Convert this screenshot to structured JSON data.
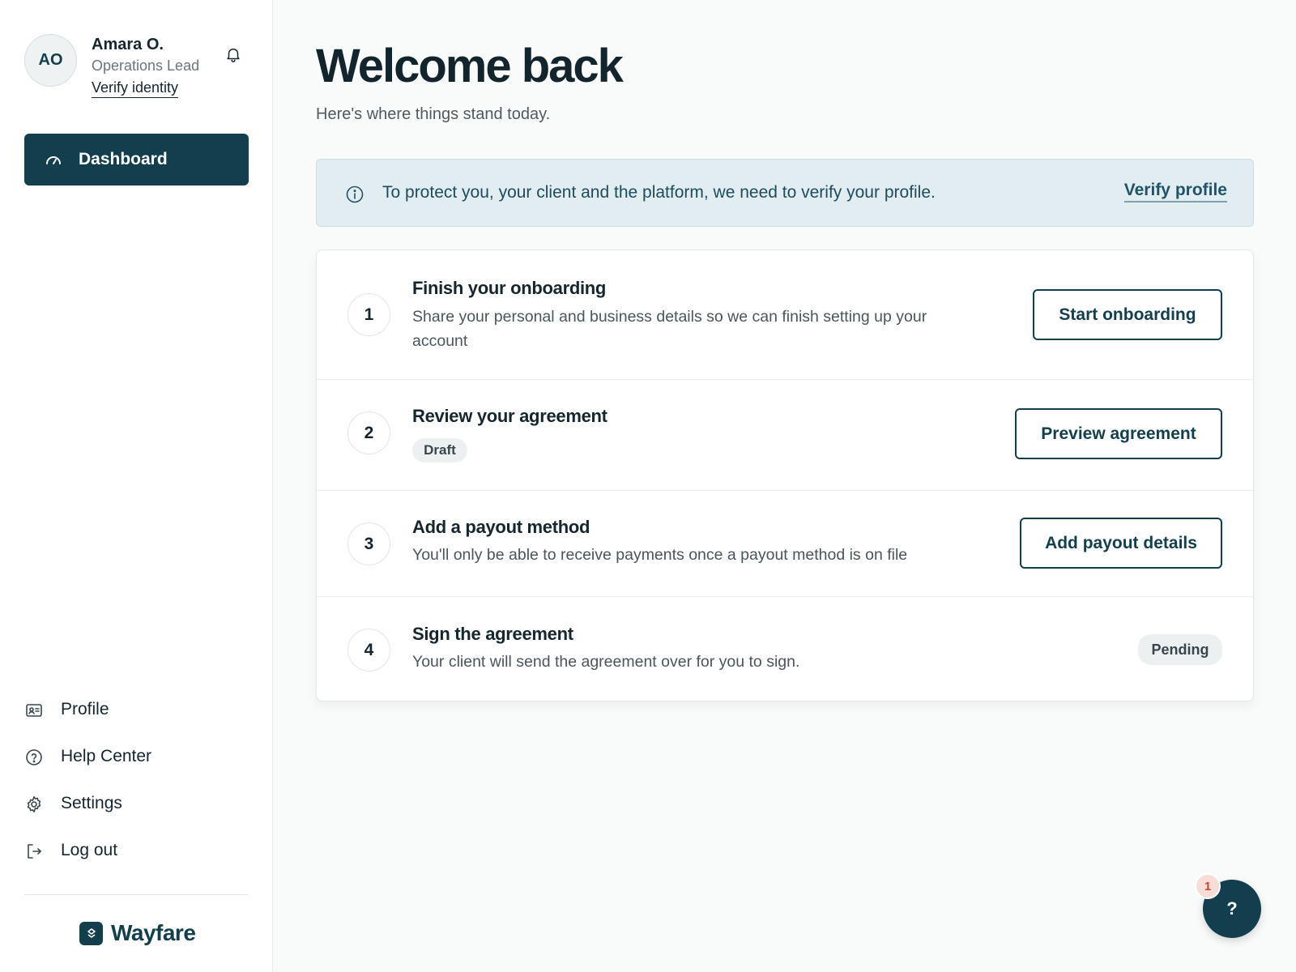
{
  "user": {
    "initials": "AO",
    "name": "Amara O.",
    "role": "Operations Lead",
    "verify_label": "Verify identity"
  },
  "nav": {
    "primary": {
      "label": "Dashboard",
      "icon": "gauge-icon",
      "active": true
    },
    "secondary": [
      {
        "label": "Profile",
        "icon": "id-card-icon"
      },
      {
        "label": "Help Center",
        "icon": "question-circle-icon"
      },
      {
        "label": "Settings",
        "icon": "gear-icon"
      },
      {
        "label": "Log out",
        "icon": "logout-icon"
      }
    ]
  },
  "brand": {
    "name": "Wayfare"
  },
  "main": {
    "title": "Welcome back",
    "subtitle": "Here's where things stand today."
  },
  "banner": {
    "text": "To protect you, your client and the platform, we need to verify your profile.",
    "link": "Verify profile"
  },
  "steps": [
    {
      "number": "1",
      "title": "Finish your onboarding",
      "description": "Share your personal and business details so we can finish setting up your account",
      "action": "Start onboarding"
    },
    {
      "number": "2",
      "title": "Review your agreement",
      "badge": "Draft",
      "action": "Preview agreement"
    },
    {
      "number": "3",
      "title": "Add a payout method",
      "description": "You'll only be able to receive payments once a payout method is on file",
      "action": "Add payout details"
    },
    {
      "number": "4",
      "title": "Sign the agreement",
      "description": "Your client will send the agreement over for you to sign.",
      "status": "Pending"
    }
  ],
  "help": {
    "label": "?",
    "count": "1"
  },
  "colors": {
    "primary": "#123e4d",
    "banner_bg": "#e2edf1",
    "badge_bg": "#edf0f1",
    "notification": "#f7ddd6"
  }
}
